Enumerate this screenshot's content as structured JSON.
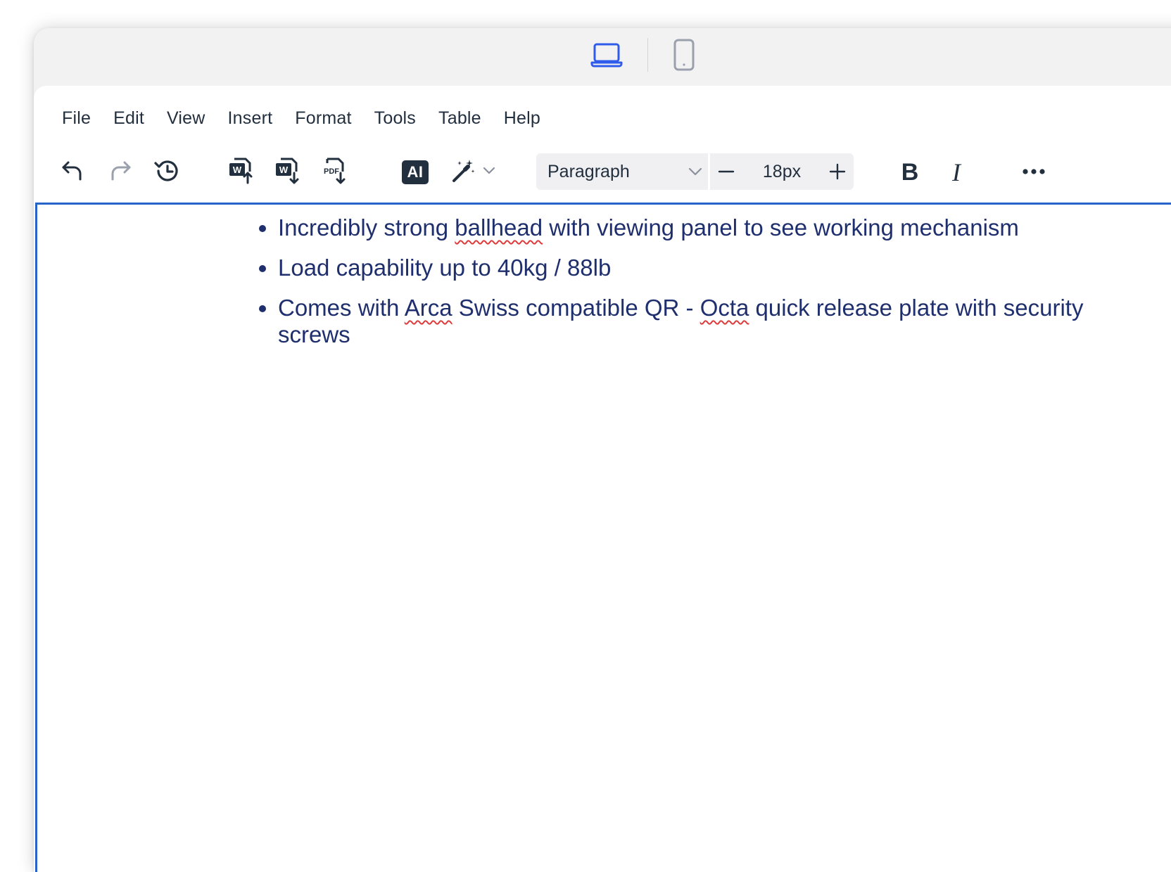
{
  "device_bar": {
    "desktop_icon": "laptop-icon",
    "mobile_icon": "phone-icon",
    "accent_color": "#2f5bea"
  },
  "menubar": {
    "items": [
      "File",
      "Edit",
      "View",
      "Insert",
      "Format",
      "Tools",
      "Table",
      "Help"
    ]
  },
  "toolbar": {
    "undo_icon": "undo-icon",
    "redo_icon": "redo-icon",
    "history_icon": "history-icon",
    "import_word_icon": "import-word-icon",
    "export_word_icon": "export-word-icon",
    "export_pdf_icon": "export-pdf-icon",
    "ai_label": "AI",
    "magic_icon": "magic-wand-icon",
    "block_format": "Paragraph",
    "font_size": "18px",
    "bold_label": "B",
    "italic_label": "I",
    "more_icon": "more-icon"
  },
  "document": {
    "bullets": [
      {
        "parts": [
          "Incredibly strong ",
          "ballhead",
          " with viewing panel to see working mechanism"
        ]
      },
      {
        "parts": [
          "Load capability up to 40kg / 88lb"
        ]
      },
      {
        "parts": [
          "Comes with ",
          "Arca",
          " Swiss compatible QR - ",
          "Octa",
          " quick release plate with security screws"
        ]
      }
    ],
    "text_color": "#1f2f6e",
    "focus_border_color": "#2563c9",
    "spellcheck_color": "#e03b3b"
  }
}
